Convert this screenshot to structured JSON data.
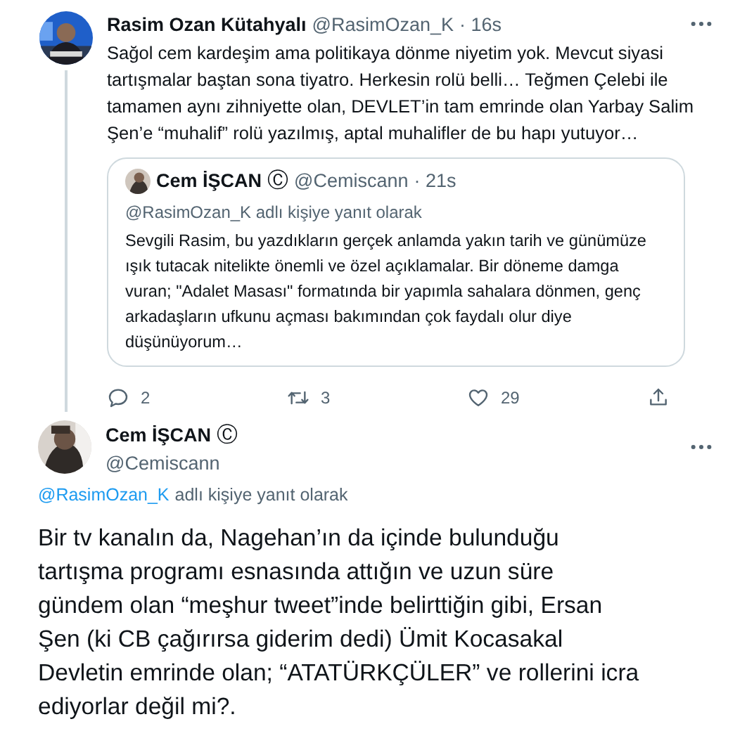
{
  "parent_tweet": {
    "name": "Rasim Ozan Kütahyalı",
    "handle": "@RasimOzan_K",
    "time": "· 16s",
    "text": "Sağol cem kardeşim ama politikaya dönme niyetim yok. Mevcut siyasi tartışmalar baştan sona tiyatro. Herkesin rolü belli… Teğmen Çelebi ile tamamen aynı zihniyette olan, DEVLET’in tam emrinde olan Yarbay Salim Şen’e “muhalif” rolü yazılmış, aptal muhalifler de bu hapı yutuyor…",
    "quoted": {
      "name": "Cem İŞCAN",
      "badge": "Ⓒ",
      "handle": "@Cemiscann",
      "time": "· 21s",
      "reply_line": "@RasimOzan_K adlı kişiye yanıt olarak",
      "text": "Sevgili Rasim, bu yazdıkların gerçek anlamda yakın tarih ve günümüze ışık tutacak nitelikte önemli ve özel açıklamalar. Bir döneme damga vuran; \"Adalet Masası\" formatında bir yapımla sahalara dönmen, genç arkadaşların ufkunu açması bakımından çok faydalı olur diye düşünüyorum…"
    },
    "actions": [
      {
        "kind": "reply",
        "count": "2"
      },
      {
        "kind": "retweet",
        "count": "3"
      },
      {
        "kind": "like",
        "count": "29"
      },
      {
        "kind": "share"
      }
    ]
  },
  "main_tweet": {
    "name": "Cem İŞCAN",
    "badge": "Ⓒ",
    "handle": "@Cemiscann",
    "reply_handle": "@RasimOzan_K",
    "reply_text": "adlı kişiye yanıt olarak",
    "text": "Bir tv kanalın da, Nagehan’ın da içinde bulunduğu tartışma programı esnasında attığın ve uzun süre gündem olan “meşhur tweet”inde belirttiğin gibi, Ersan Şen (ki CB çağırırsa giderim dedi) Ümit Kocasakal Devletin emrinde olan; “ATATÜRKÇÜLER” ve rollerini icra ediyorlar değil mi?."
  }
}
